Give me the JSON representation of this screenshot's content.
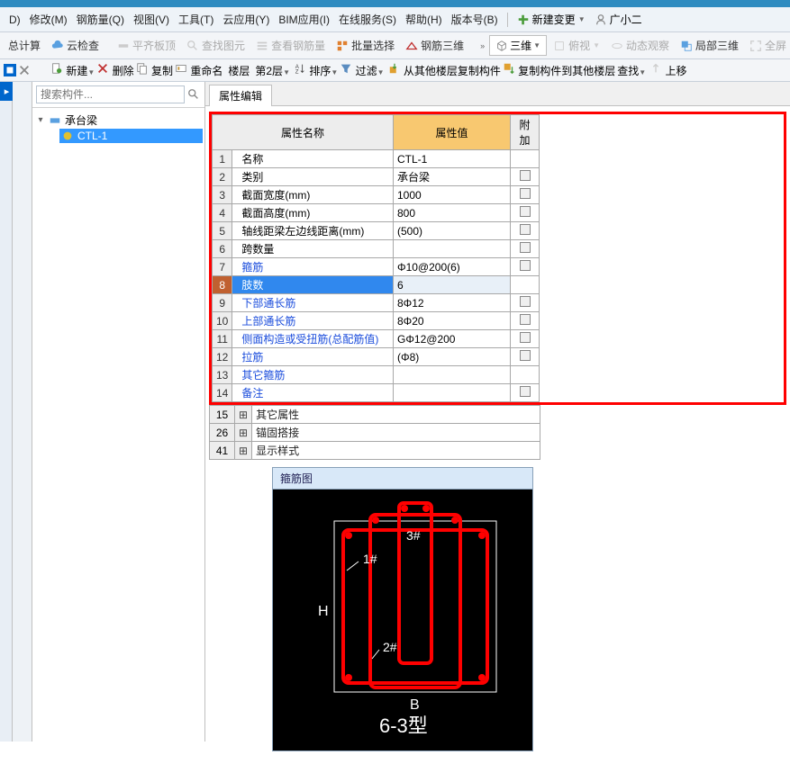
{
  "menubar": {
    "items": [
      "D)",
      "修改(M)",
      "钢筋量(Q)",
      "视图(V)",
      "工具(T)",
      "云应用(Y)",
      "BIM应用(I)",
      "在线服务(S)",
      "帮助(H)",
      "版本号(B)"
    ],
    "newchange": "新建变更",
    "user": "广小二"
  },
  "toolbar1": {
    "calc": "总计算",
    "cloudcheck": "云检查",
    "flat": "平齐板顶",
    "findview": "查找图元",
    "viewrebar": "查看钢筋量",
    "batchsel": "批量选择",
    "rebar3d": "钢筋三维",
    "dropdown": "三维",
    "view2d": "俯视",
    "dynview": "动态观察",
    "local3d": "局部三维",
    "fullscreen": "全屏"
  },
  "toolbar2": {
    "new": "新建",
    "delete": "删除",
    "copy": "复制",
    "rename": "重命名",
    "floor_label": "楼层",
    "floor_value": "第2层",
    "sort": "排序",
    "filter": "过滤",
    "copyfrom": "从其他楼层复制构件",
    "copyto": "复制构件到其他楼层",
    "find": "查找",
    "moveup": "上移"
  },
  "sidebar": {
    "search_placeholder": "搜索构件...",
    "root": "承台梁",
    "child": "CTL-1"
  },
  "content": {
    "tab": "属性编辑",
    "headers": {
      "name": "属性名称",
      "value": "属性值",
      "extra": "附加"
    },
    "rows": [
      {
        "n": "1",
        "name": "名称",
        "val": "CTL-1",
        "link": false,
        "chk": false
      },
      {
        "n": "2",
        "name": "类别",
        "val": "承台梁",
        "link": false,
        "chk": true
      },
      {
        "n": "3",
        "name": "截面宽度(mm)",
        "val": "1000",
        "link": false,
        "chk": true
      },
      {
        "n": "4",
        "name": "截面高度(mm)",
        "val": "800",
        "link": false,
        "chk": true
      },
      {
        "n": "5",
        "name": "轴线距梁左边线距离(mm)",
        "val": "(500)",
        "link": false,
        "chk": true
      },
      {
        "n": "6",
        "name": "跨数量",
        "val": "",
        "link": false,
        "chk": true
      },
      {
        "n": "7",
        "name": "箍筋",
        "val": "Φ10@200(6)",
        "link": true,
        "chk": true
      },
      {
        "n": "8",
        "name": "肢数",
        "val": "6",
        "link": true,
        "chk": false,
        "sel": true
      },
      {
        "n": "9",
        "name": "下部通长筋",
        "val": "8Φ12",
        "link": true,
        "chk": true
      },
      {
        "n": "10",
        "name": "上部通长筋",
        "val": "8Φ20",
        "link": true,
        "chk": true
      },
      {
        "n": "11",
        "name": "侧面构造或受扭筋(总配筋值)",
        "val": "GΦ12@200",
        "link": true,
        "chk": true
      },
      {
        "n": "12",
        "name": "拉筋",
        "val": "(Φ8)",
        "link": true,
        "chk": true
      },
      {
        "n": "13",
        "name": "其它箍筋",
        "val": "",
        "link": true,
        "chk": false
      },
      {
        "n": "14",
        "name": "备注",
        "val": "",
        "link": true,
        "chk": true
      }
    ],
    "groups": [
      {
        "n": "15",
        "label": "其它属性"
      },
      {
        "n": "26",
        "label": "锚固搭接"
      },
      {
        "n": "41",
        "label": "显示样式"
      }
    ],
    "diagram": {
      "title": "箍筋图",
      "labels": {
        "l1": "1#",
        "l2": "2#",
        "l3": "3#",
        "H": "H",
        "B": "B",
        "type": "6-3型"
      }
    }
  }
}
